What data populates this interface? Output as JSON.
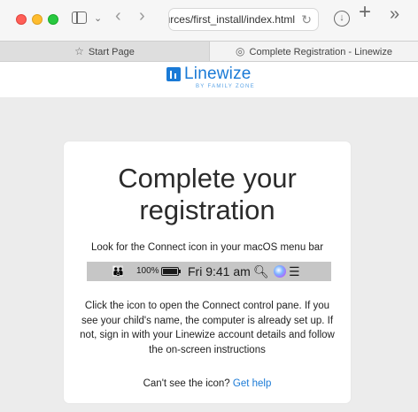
{
  "toolbar": {
    "url": "sources/first_install/index.html",
    "sidebar_chevron": "⌄",
    "back_glyph": "‹",
    "forward_glyph": "›",
    "reload_glyph": "↻",
    "download_glyph": "↓",
    "new_tab_glyph": "+",
    "more_glyph": "»"
  },
  "tabs": [
    {
      "label": "Start Page",
      "icon": "star-icon",
      "glyph": "☆",
      "active": false
    },
    {
      "label": "Complete Registration - Linewize",
      "icon": "compass-icon",
      "glyph": "◎",
      "active": true
    }
  ],
  "brand": {
    "name": "Linewize",
    "tagline": "BY FAMILY ZONE",
    "color": "#1a7ad6"
  },
  "card": {
    "title": "Complete your registration",
    "lead": "Look for the Connect icon in your macOS menu bar",
    "menubar": {
      "people_glyph": "👪",
      "battery_percent": "100%",
      "clock": "Fri 9:41 am",
      "search_glyph": "🔍︎",
      "control_glyph": "☰"
    },
    "body": "Click the icon to open the Connect control pane. If you see your child's name, the computer is already set up. If not, sign in with your Linewize account details and follow the on-screen instructions",
    "help_prompt": "Can't see the icon?",
    "help_link": "Get help"
  }
}
